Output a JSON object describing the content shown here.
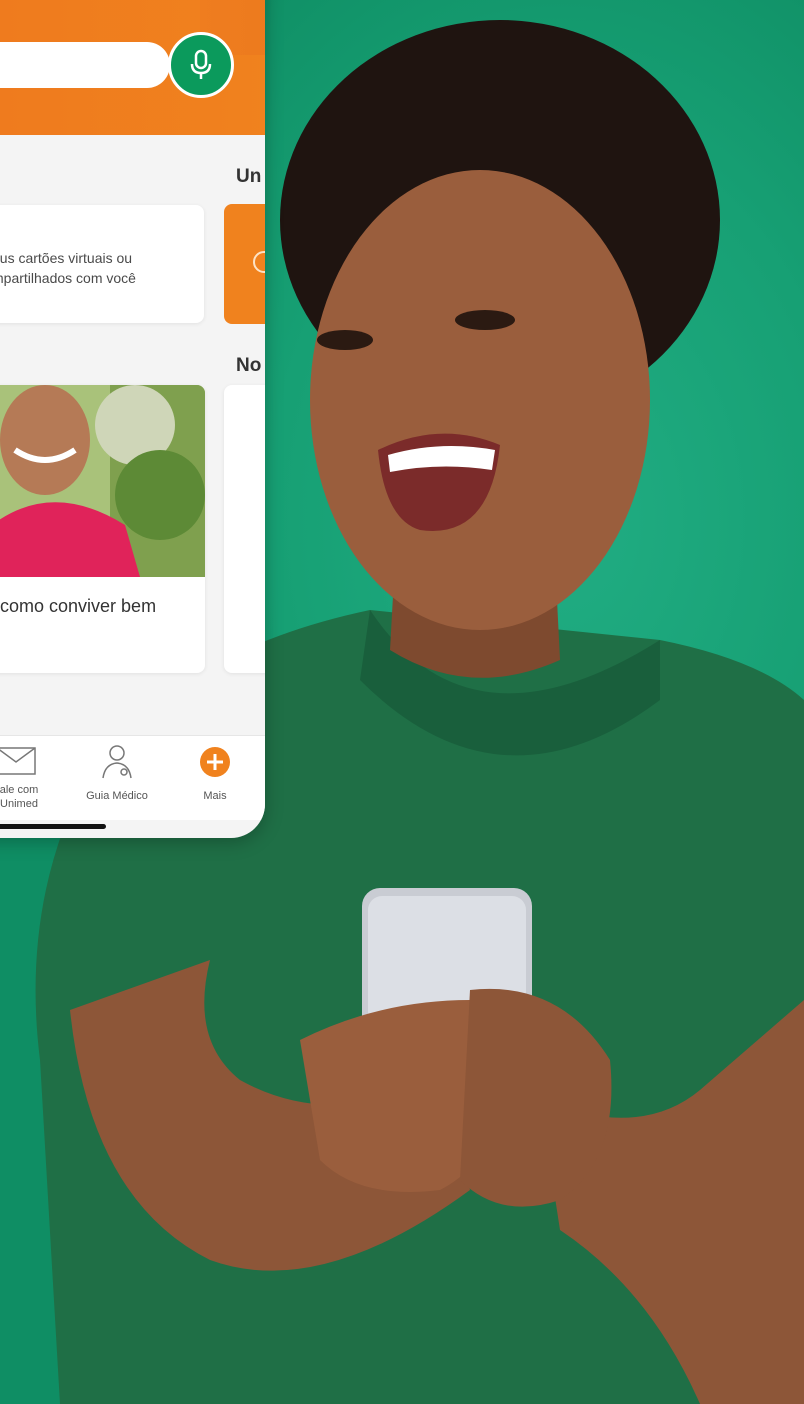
{
  "app": {
    "name": "Unimed"
  },
  "search": {
    "mic_icon": "microphone-icon"
  },
  "sections": {
    "unimed_label": "Un",
    "news_label": "No"
  },
  "card_virtual": {
    "line1": "eus cartões virtuais ou",
    "line2": "mpartilhados com você"
  },
  "news_card": {
    "title": "como conviver bem"
  },
  "tabs": [
    {
      "line1": "ale com",
      "line2": "Unimed",
      "icon": "envelope-icon"
    },
    {
      "line1": "Guia Médico",
      "line2": "",
      "icon": "doctor-icon"
    },
    {
      "line1": "Mais",
      "line2": "",
      "icon": "plus-circle-icon"
    }
  ],
  "colors": {
    "brand_orange": "#F0821E",
    "brand_green": "#0B9A5C",
    "background_green": "#1AA277"
  }
}
